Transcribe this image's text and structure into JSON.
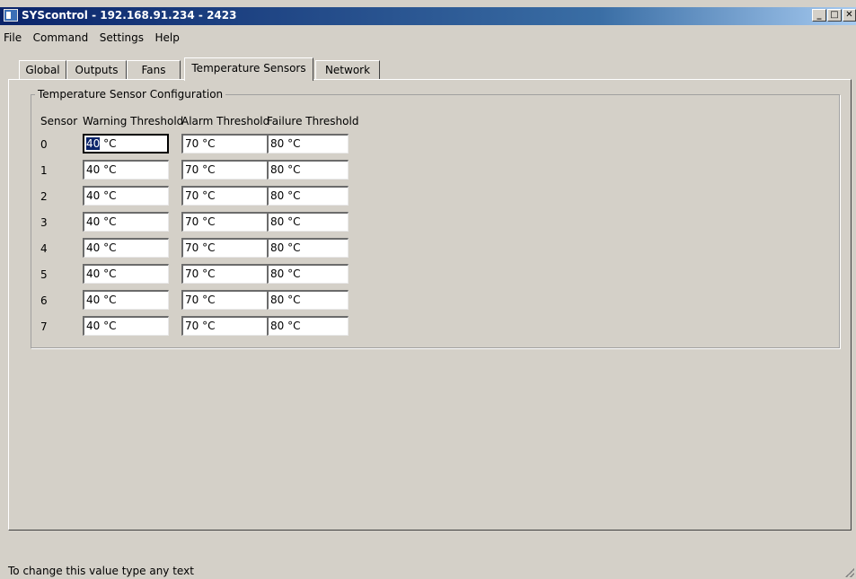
{
  "window": {
    "title": "SYScontrol - 192.168.91.234 - 2423",
    "controls": {
      "minimize": "_",
      "maximize": "□",
      "close": "✕"
    }
  },
  "menu": [
    "File",
    "Command",
    "Settings",
    "Help"
  ],
  "tabs": [
    {
      "label": "Global",
      "active": false
    },
    {
      "label": "Outputs",
      "active": false
    },
    {
      "label": "Fans",
      "active": false
    },
    {
      "label": "Temperature Sensors",
      "active": true
    },
    {
      "label": "Network",
      "active": false
    }
  ],
  "group": {
    "title": "Temperature Sensor Configuration",
    "headers": [
      "Sensor",
      "Warning Threshold",
      "Alarm Threshold",
      "Failure Threshold"
    ],
    "rows": [
      {
        "sensor": "0",
        "warning": "40 °C",
        "alarm": "70 °C",
        "failure": "80 °C"
      },
      {
        "sensor": "1",
        "warning": "40 °C",
        "alarm": "70 °C",
        "failure": "80 °C"
      },
      {
        "sensor": "2",
        "warning": "40 °C",
        "alarm": "70 °C",
        "failure": "80 °C"
      },
      {
        "sensor": "3",
        "warning": "40 °C",
        "alarm": "70 °C",
        "failure": "80 °C"
      },
      {
        "sensor": "4",
        "warning": "40 °C",
        "alarm": "70 °C",
        "failure": "80 °C"
      },
      {
        "sensor": "5",
        "warning": "40 °C",
        "alarm": "70 °C",
        "failure": "80 °C"
      },
      {
        "sensor": "6",
        "warning": "40 °C",
        "alarm": "70 °C",
        "failure": "80 °C"
      },
      {
        "sensor": "7",
        "warning": "40 °C",
        "alarm": "70 °C",
        "failure": "80 °C"
      }
    ],
    "focused_field": {
      "row": 0,
      "column": "warning",
      "selected_text": "40",
      "rest_text": " °C"
    }
  },
  "status": {
    "text": "To change this value type any text"
  }
}
